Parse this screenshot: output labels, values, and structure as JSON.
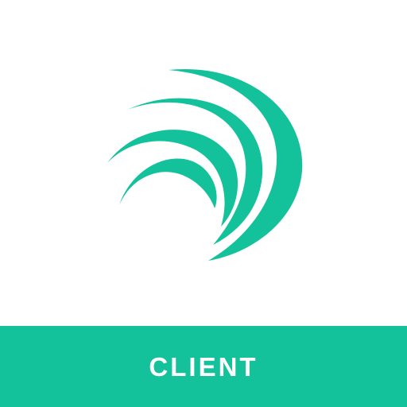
{
  "app_icon": {
    "label": "CLIENT",
    "icon": "wave-arcs-icon"
  },
  "colors": {
    "background": "#ffffff",
    "brand_green": "#13c29a",
    "label_text": "#ffffff"
  }
}
